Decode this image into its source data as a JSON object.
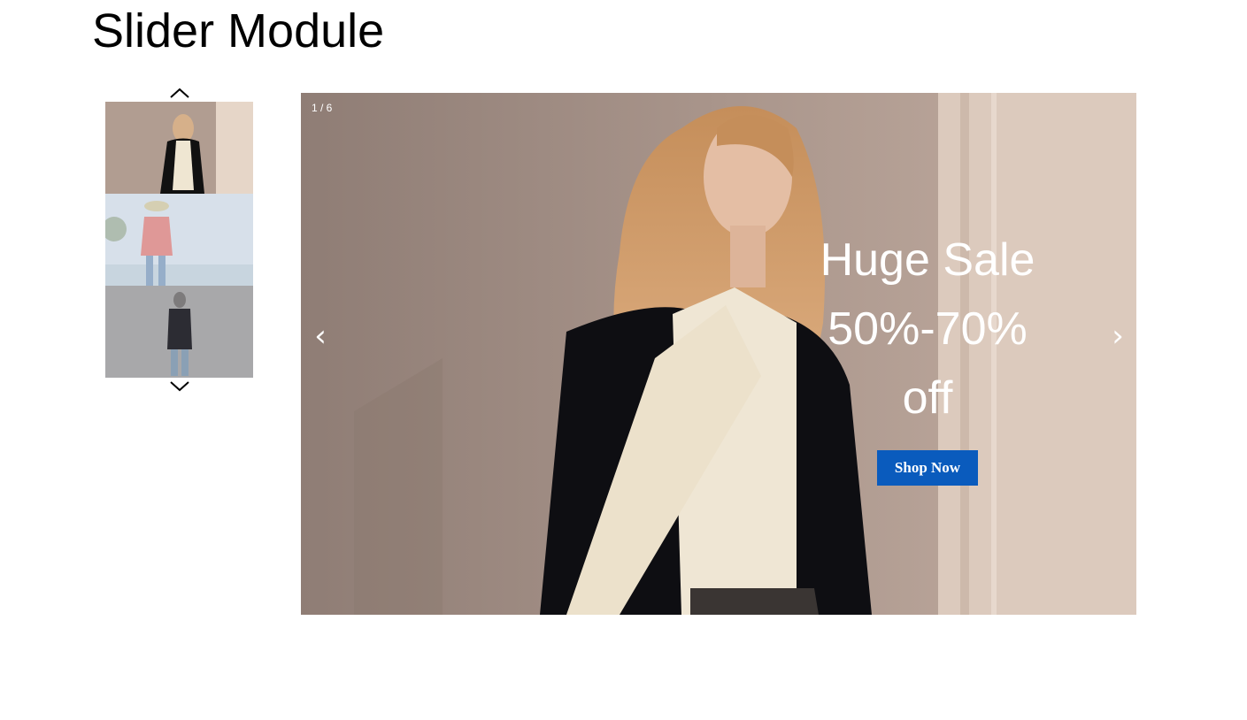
{
  "page": {
    "title": "Slider Module"
  },
  "thumbnails": {
    "up_icon": "chevron-up-icon",
    "down_icon": "chevron-down-icon",
    "items": [
      {
        "name": "thumbnail-1",
        "active": true
      },
      {
        "name": "thumbnail-2",
        "active": false
      },
      {
        "name": "thumbnail-3",
        "active": false
      }
    ]
  },
  "slider": {
    "counter": "1 / 6",
    "prev_label": "‹",
    "next_label": "›",
    "headline": "Huge Sale 50%-70% off",
    "cta_label": "Shop Now",
    "cta_color": "#0a5bbd"
  }
}
